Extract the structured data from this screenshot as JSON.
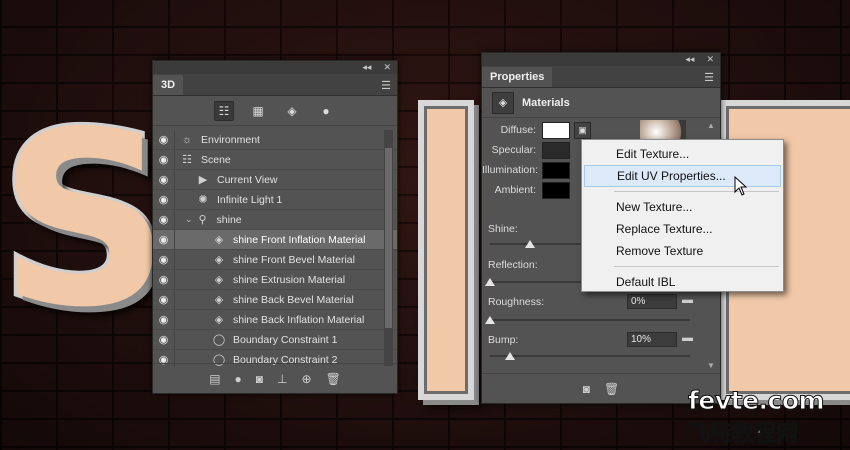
{
  "colors": {
    "panel_bg": "#535353",
    "menu_bg": "#f0f0f0",
    "menu_hover": "#dbe9f8",
    "letter_fill": "#f2c9a8"
  },
  "background": {
    "letters": [
      "S",
      "I",
      "E"
    ]
  },
  "panel3d": {
    "tab_label": "3D",
    "collapse_icon": "double-chevron-left",
    "close_icon": "close-x",
    "menu_icon": "panel-menu",
    "filter_icons": [
      "scene-filter-icon",
      "mesh-filter-icon",
      "material-filter-icon",
      "light-filter-icon"
    ],
    "rows": [
      {
        "label": "Environment",
        "icon": "environment-icon",
        "indent": 0,
        "selected": false
      },
      {
        "label": "Scene",
        "icon": "scene-icon",
        "indent": 0,
        "selected": false
      },
      {
        "label": "Current View",
        "icon": "camera-icon",
        "indent": 1,
        "selected": false
      },
      {
        "label": "Infinite Light 1",
        "icon": "light-icon",
        "indent": 1,
        "selected": false
      },
      {
        "label": "shine",
        "icon": "mesh-icon",
        "indent": 1,
        "selected": false
      },
      {
        "label": "shine Front Inflation Material",
        "icon": "material-icon",
        "indent": 2,
        "selected": true
      },
      {
        "label": "shine Front Bevel Material",
        "icon": "material-icon",
        "indent": 2,
        "selected": false
      },
      {
        "label": "shine Extrusion Material",
        "icon": "material-icon",
        "indent": 2,
        "selected": false
      },
      {
        "label": "shine Back Bevel Material",
        "icon": "material-icon",
        "indent": 2,
        "selected": false
      },
      {
        "label": "shine Back Inflation Material",
        "icon": "material-icon",
        "indent": 2,
        "selected": false
      },
      {
        "label": "Boundary Constraint 1",
        "icon": "constraint-icon",
        "indent": 2,
        "selected": false
      },
      {
        "label": "Boundary Constraint 2",
        "icon": "constraint-icon",
        "indent": 2,
        "selected": false
      }
    ],
    "footer_icons": [
      "render-icon",
      "add-light-icon",
      "material-drop-icon",
      "move-to-ground-icon",
      "add-constraint-icon",
      "delete-icon"
    ]
  },
  "properties": {
    "tab_label": "Properties",
    "section_title": "Materials",
    "labels": {
      "diffuse": "Diffuse:",
      "specular": "Specular:",
      "illumination": "Illumination:",
      "ambient": "Ambient:",
      "shine": "Shine:",
      "reflection": "Reflection:",
      "roughness": "Roughness:",
      "bump": "Bump:"
    },
    "swatches": {
      "diffuse": "#ffffff",
      "specular": "#2a2a2a",
      "illumination": "#000000",
      "ambient": "#000000"
    },
    "values": {
      "roughness": "0%",
      "bump": "10%"
    },
    "slider_levels": {
      "shine": 0.2,
      "reflection": 0.0,
      "roughness": 0.0,
      "bump": 0.1
    }
  },
  "context_menu": {
    "items": [
      {
        "label": "Edit Texture...",
        "hover": false,
        "sep_after": false
      },
      {
        "label": "Edit UV Properties...",
        "hover": true,
        "sep_after": true
      },
      {
        "label": "New Texture...",
        "hover": false,
        "sep_after": false
      },
      {
        "label": "Replace Texture...",
        "hover": false,
        "sep_after": false
      },
      {
        "label": "Remove Texture",
        "hover": false,
        "sep_after": true
      },
      {
        "label": "Default IBL",
        "hover": false,
        "sep_after": false
      }
    ]
  },
  "watermark": {
    "line1": "fevte.com",
    "line2": "飞特教程网"
  }
}
